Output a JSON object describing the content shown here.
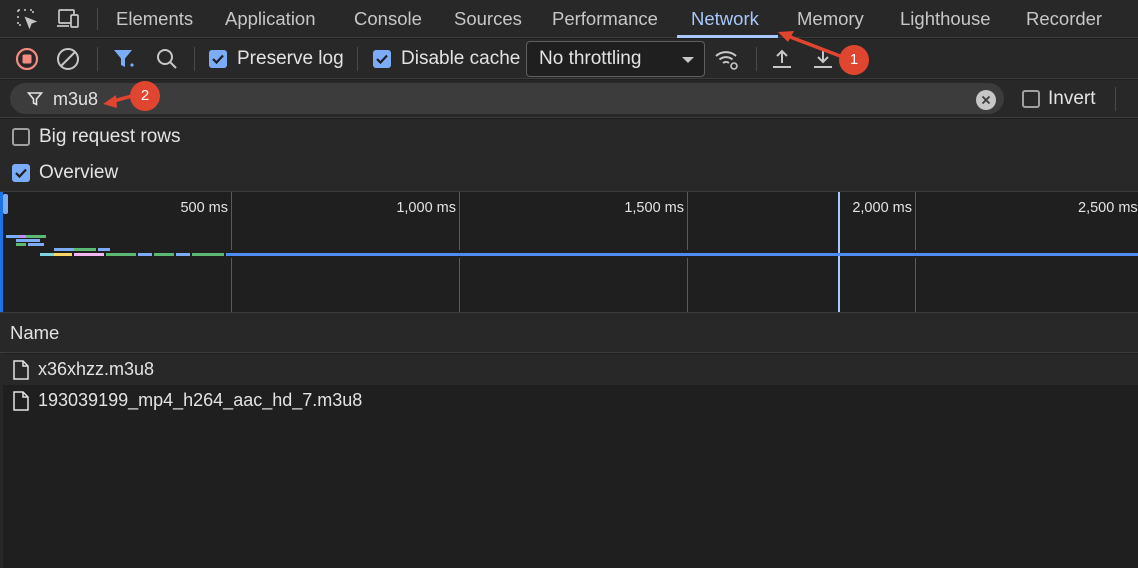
{
  "tabs": [
    {
      "label": "Elements",
      "active": false
    },
    {
      "label": "Application",
      "active": false
    },
    {
      "label": "Console",
      "active": false
    },
    {
      "label": "Sources",
      "active": false
    },
    {
      "label": "Performance",
      "active": false
    },
    {
      "label": "Network",
      "active": true
    },
    {
      "label": "Memory",
      "active": false
    },
    {
      "label": "Lighthouse",
      "active": false
    },
    {
      "label": "Recorder",
      "active": false
    }
  ],
  "tabbar_icons": [
    "inspect-element-icon",
    "device-toolbar-icon"
  ],
  "toolbar": {
    "icons": [
      "record-stop-icon",
      "clear-icon",
      "filter-icon",
      "search-icon"
    ],
    "preserve_log": {
      "label": "Preserve log",
      "checked": true
    },
    "disable_cache": {
      "label": "Disable cache",
      "checked": true
    },
    "throttling": {
      "selected": "No throttling"
    },
    "right_icons": [
      "network-conditions-icon",
      "import-har-icon",
      "export-har-icon"
    ]
  },
  "filter": {
    "value": "m3u8",
    "invert": {
      "label": "Invert",
      "checked": false
    }
  },
  "options": {
    "big_request_rows": {
      "label": "Big request rows",
      "checked": false
    },
    "overview": {
      "label": "Overview",
      "checked": true
    }
  },
  "timeline": {
    "tick_labels": [
      "500 ms",
      "1,000 ms",
      "1,500 ms",
      "2,000 ms",
      "2,500 ms"
    ]
  },
  "table": {
    "header": "Name",
    "rows": [
      {
        "name": "x36xhzz.m3u8"
      },
      {
        "name": "193039199_mp4_h264_aac_hd_7.m3u8"
      }
    ]
  },
  "annotations": [
    {
      "label": "1"
    },
    {
      "label": "2"
    }
  ],
  "colors": {
    "accent": "#a8c7fa",
    "record_red": "#f28b82",
    "checkbox_blue": "#7cacf8",
    "annotation_red": "#e0452f"
  }
}
